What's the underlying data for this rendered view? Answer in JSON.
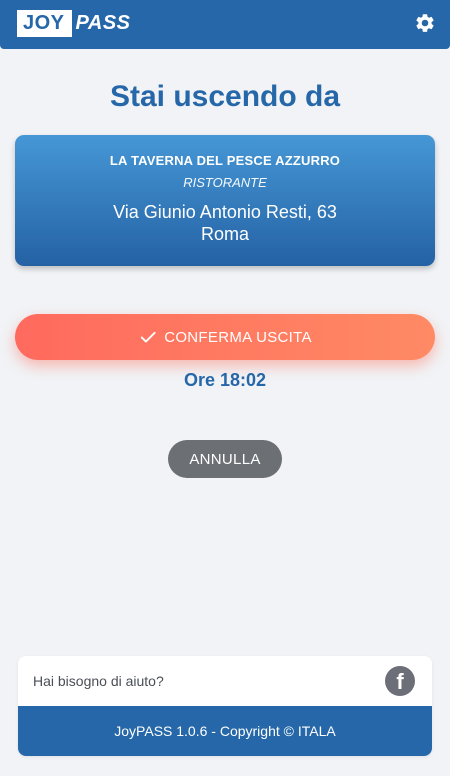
{
  "header": {
    "logo_left": "JOY",
    "logo_right": "PASS",
    "settings_icon": "gear-icon"
  },
  "main": {
    "title": "Stai uscendo da",
    "venue": {
      "name": "LA TAVERNA DEL PESCE AZZURRO",
      "type": "RISTORANTE",
      "address": "Via Giunio Antonio Resti, 63",
      "city": "Roma"
    },
    "confirm_label": "CONFERMA USCITA",
    "confirm_icon": "check-icon",
    "time_label": "Ore 18:02",
    "cancel_label": "ANNULLA"
  },
  "footer": {
    "help_text": "Hai bisogno di aiuto?",
    "facebook_icon": "facebook-icon",
    "copyright": "JoyPASS 1.0.6 - Copyright © ITALA"
  },
  "colors": {
    "primary": "#2567a8",
    "confirm_gradient_start": "#ff6a5e",
    "confirm_gradient_end": "#ff8a64",
    "cancel_bg": "#6c7074",
    "page_bg": "#f1f3f6"
  }
}
